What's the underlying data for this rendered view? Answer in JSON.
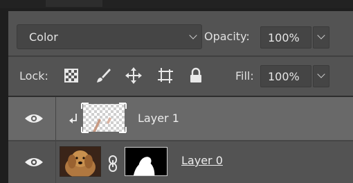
{
  "blend_mode": {
    "value": "Color"
  },
  "opacity": {
    "label": "Opacity:",
    "value": "100%"
  },
  "lock": {
    "label": "Lock:",
    "icons": [
      "lock-transparent-pixels-icon",
      "lock-image-pixels-icon",
      "lock-position-icon",
      "lock-artboard-icon",
      "lock-all-icon"
    ]
  },
  "fill": {
    "label": "Fill:",
    "value": "100%"
  },
  "layers": [
    {
      "name": "Layer 1",
      "visible": true,
      "clipped": true,
      "selected": true
    },
    {
      "name": "Layer 0",
      "visible": true,
      "has_mask": true,
      "selected": false
    }
  ],
  "colors": {
    "panel": "#535353",
    "selected_row": "#696969",
    "field": "#454545"
  }
}
